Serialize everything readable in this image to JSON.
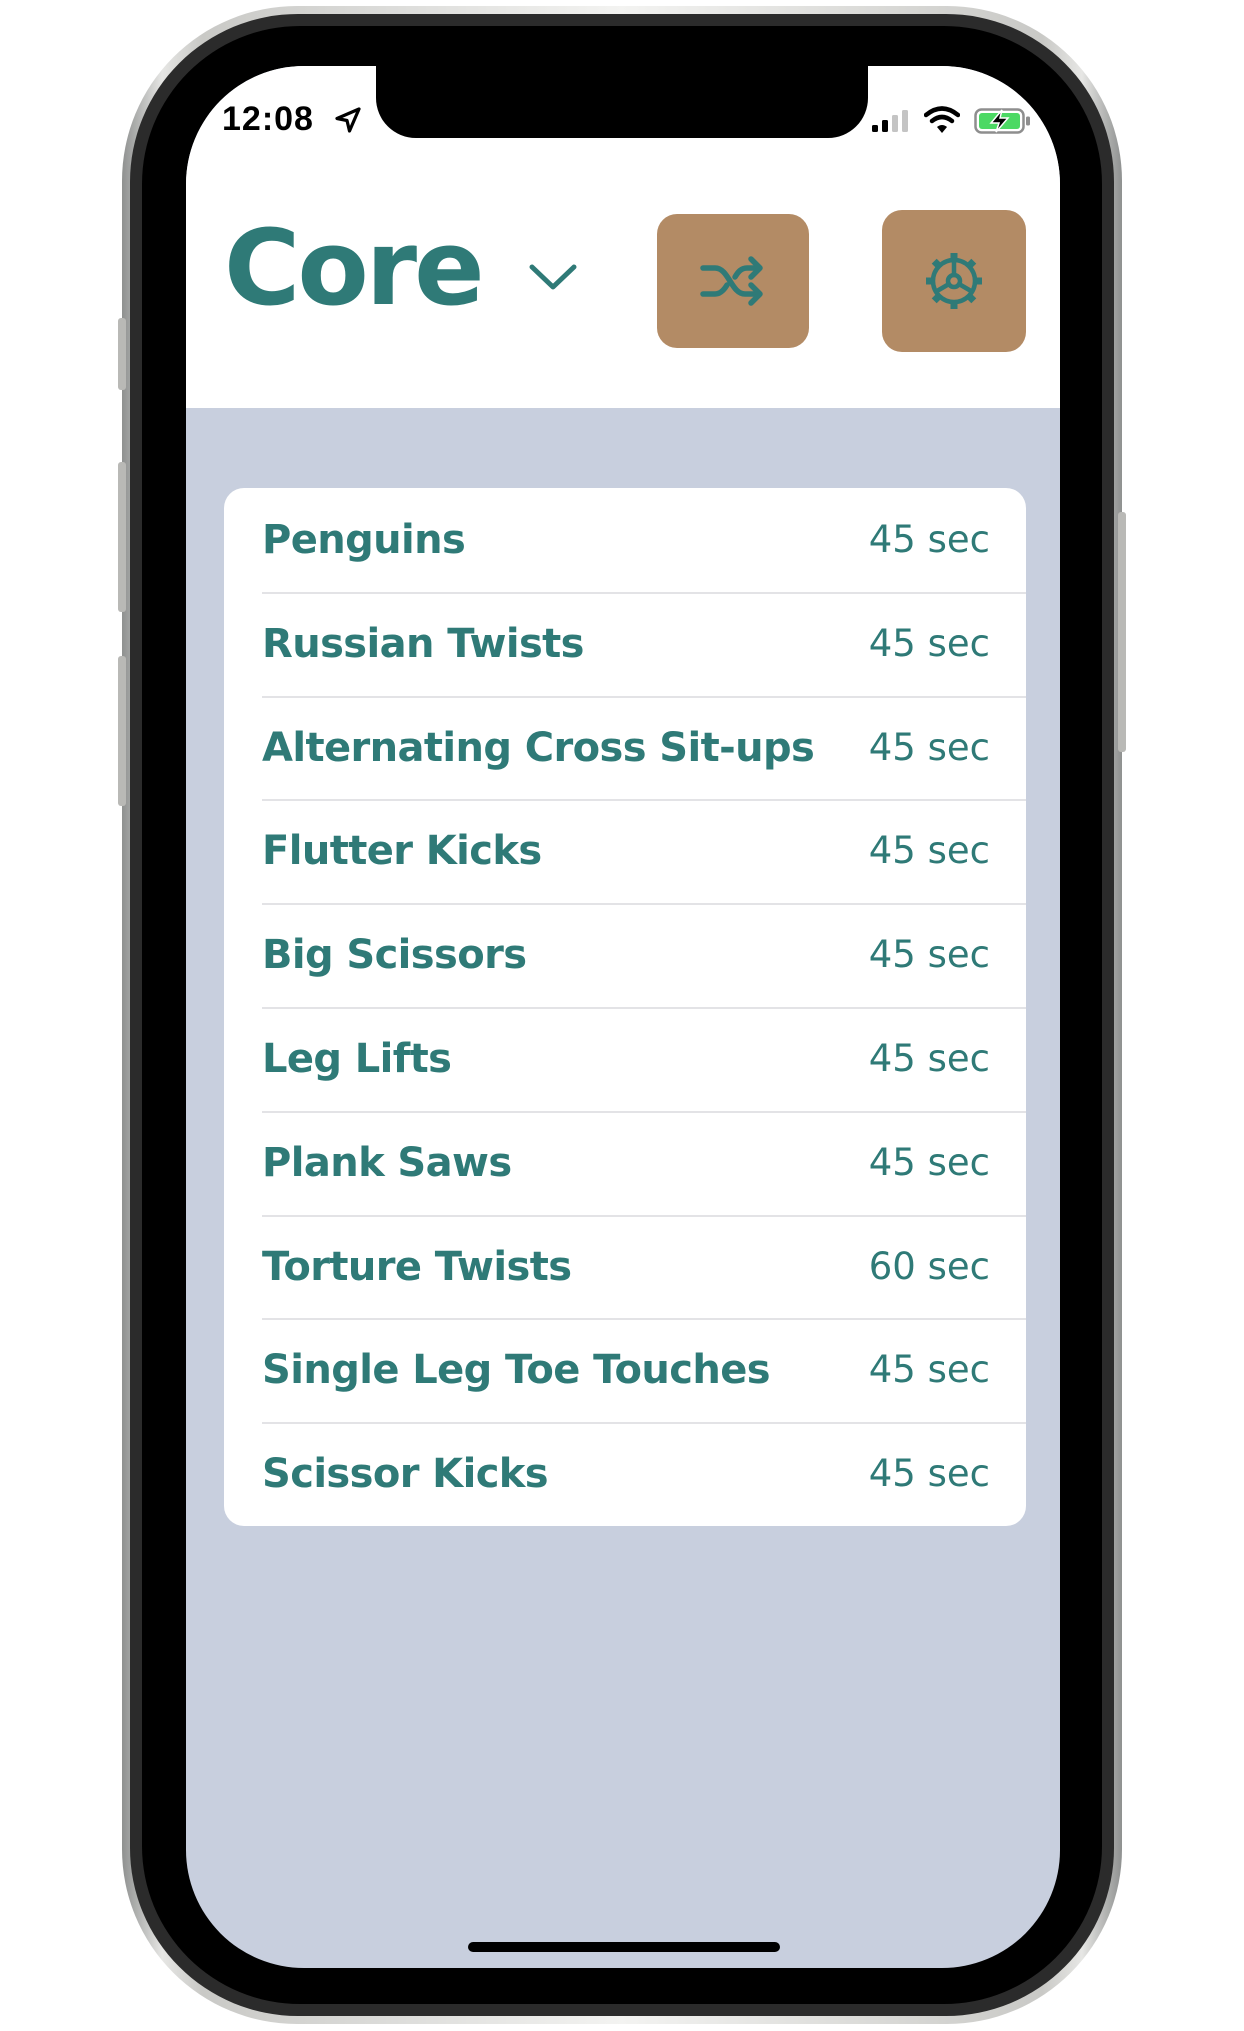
{
  "status_bar": {
    "time": "12:08",
    "icons": [
      "location-arrow-icon",
      "cellular-signal-icon",
      "wifi-icon",
      "battery-charging-icon"
    ]
  },
  "header": {
    "title": "Core",
    "dropdown_icon": "chevron-down-icon",
    "shuffle_icon": "shuffle-icon",
    "settings_icon": "gear-icon"
  },
  "exercises": [
    {
      "name": "Penguins",
      "duration": "45 sec"
    },
    {
      "name": "Russian Twists",
      "duration": "45 sec"
    },
    {
      "name": "Alternating Cross Sit-ups",
      "duration": "45 sec"
    },
    {
      "name": "Flutter Kicks",
      "duration": "45 sec"
    },
    {
      "name": "Big Scissors",
      "duration": "45 sec"
    },
    {
      "name": "Leg Lifts",
      "duration": "45 sec"
    },
    {
      "name": "Plank Saws",
      "duration": "45 sec"
    },
    {
      "name": "Torture Twists",
      "duration": "60 sec"
    },
    {
      "name": "Single Leg Toe Touches",
      "duration": "45 sec"
    },
    {
      "name": "Scissor Kicks",
      "duration": "45 sec"
    }
  ],
  "colors": {
    "accent_text": "#2f7a77",
    "button_bg": "#b38b65",
    "list_background": "#c8cfde",
    "card_background": "#ffffff"
  }
}
